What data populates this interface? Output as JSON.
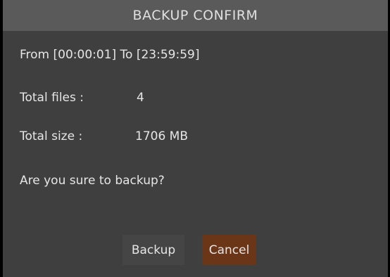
{
  "dialog": {
    "title": "BACKUP CONFIRM",
    "range_text": "From [00:00:01] To [23:59:59]",
    "total_files_label": "Total files :",
    "total_files_value": "4",
    "total_size_label": "Total size :",
    "total_size_value": "1706 MB",
    "question": "Are you sure to backup?",
    "backup_label": "Backup",
    "cancel_label": "Cancel"
  },
  "colors": {
    "title_bar": "#5a5a5a",
    "body": "#3f3f3f",
    "text": "#e6e6e6",
    "cancel_focus": "#6b3617"
  }
}
